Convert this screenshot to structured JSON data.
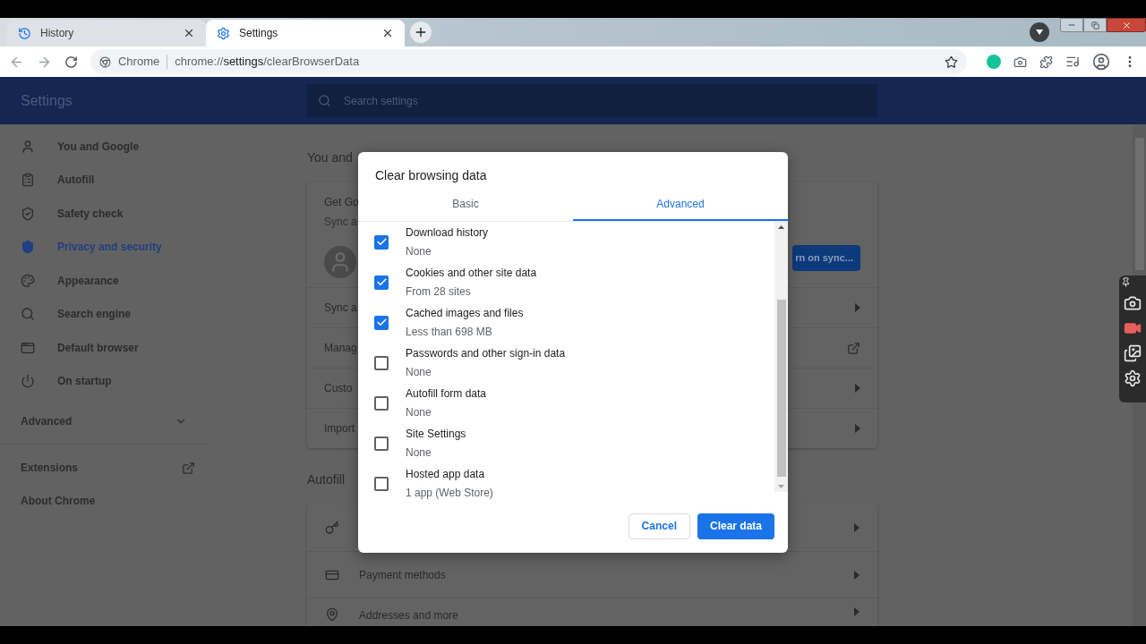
{
  "tabs": [
    {
      "title": "History",
      "selected": false
    },
    {
      "title": "Settings",
      "selected": true
    }
  ],
  "address": {
    "chip": "Chrome",
    "url": "chrome://**settings**/clearBrowserData"
  },
  "header": {
    "title": "Settings",
    "search_placeholder": "Search settings"
  },
  "sidebar": {
    "items": [
      {
        "label": "You and Google",
        "selected": false
      },
      {
        "label": "Autofill",
        "selected": false
      },
      {
        "label": "Safety check",
        "selected": false
      },
      {
        "label": "Privacy and security",
        "selected": true
      },
      {
        "label": "Appearance",
        "selected": false
      },
      {
        "label": "Search engine",
        "selected": false
      },
      {
        "label": "Default browser",
        "selected": false
      },
      {
        "label": "On startup",
        "selected": false
      }
    ],
    "advanced": "Advanced",
    "extensions": "Extensions",
    "about": "About Chrome"
  },
  "content": {
    "section_1": "You and",
    "card_title": "Get Go",
    "card_subtitle": "Sync a",
    "sync_button": "rn on sync...",
    "rows": [
      {
        "label": "Sync a",
        "kind": "caret"
      },
      {
        "label": "Manag",
        "kind": "external"
      },
      {
        "label": "Custo",
        "kind": "caret"
      },
      {
        "label": "Import",
        "kind": "caret"
      }
    ],
    "section_2": "Autofill",
    "autofill_rows": [
      {},
      {
        "label": "Payment methods"
      },
      {
        "label": "Addresses and more"
      }
    ]
  },
  "dialog": {
    "title": "Clear browsing data",
    "tabs": [
      {
        "label": "Basic",
        "selected": false
      },
      {
        "label": "Advanced",
        "selected": true
      }
    ],
    "items": [
      {
        "label": "Download history",
        "detail": "None",
        "checked": true
      },
      {
        "label": "Cookies and other site data",
        "detail": "From 28 sites",
        "checked": true
      },
      {
        "label": "Cached images and files",
        "detail": "Less than 698 MB",
        "checked": true
      },
      {
        "label": "Passwords and other sign-in data",
        "detail": "None",
        "checked": false
      },
      {
        "label": "Autofill form data",
        "detail": "None",
        "checked": false
      },
      {
        "label": "Site Settings",
        "detail": "None",
        "checked": false
      },
      {
        "label": "Hosted app data",
        "detail": "1 app (Web Store)",
        "checked": false
      }
    ],
    "cancel": "Cancel",
    "confirm": "Clear data"
  }
}
